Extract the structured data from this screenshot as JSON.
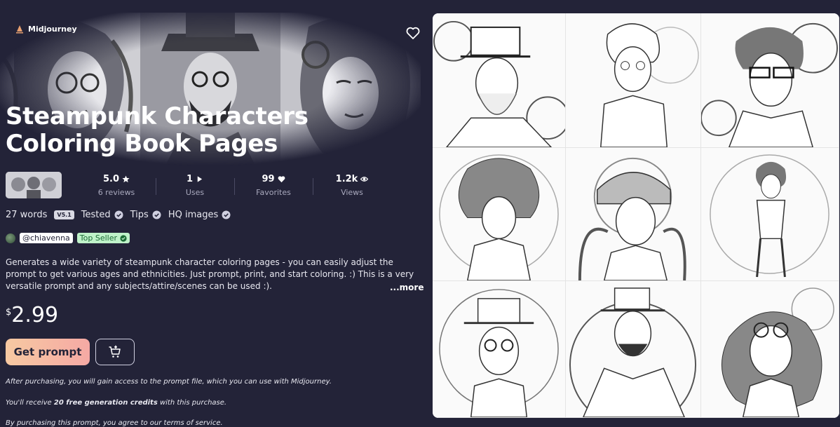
{
  "brand": {
    "name": "Midjourney",
    "icon": "sail-icon"
  },
  "favorite_icon": "heart-outline-icon",
  "title": "Steampunk Characters Coloring Book Pages",
  "stats": {
    "rating": {
      "value": "5.0",
      "label": "6 reviews",
      "icon": "star-icon"
    },
    "uses": {
      "value": "1",
      "label": "Uses",
      "icon": "play-icon"
    },
    "favorites": {
      "value": "99",
      "label": "Favorites",
      "icon": "heart-icon"
    },
    "views": {
      "value": "1.2k",
      "label": "Views",
      "icon": "eye-icon"
    }
  },
  "meta": {
    "words": "27 words",
    "version": "V5.1",
    "tested": "Tested",
    "tips": "Tips",
    "hq": "HQ images"
  },
  "seller": {
    "handle": "@chiavenna",
    "badge": "Top Seller"
  },
  "description": "Generates a wide variety of steampunk character coloring pages - you can easily adjust the prompt to get various ages and ethnicities. Just prompt, print, and  start coloring. :) This is a very versatile prompt and any subjects/attire/scenes can be used :).",
  "more_label": "...more",
  "price": {
    "currency": "$",
    "amount": "2.99"
  },
  "buttons": {
    "get_prompt": "Get prompt",
    "cart_icon": "add-to-cart-icon"
  },
  "fine_print": {
    "line1": "After purchasing, you will gain access to the prompt file, which you can use with Midjourney.",
    "line2_pre": "You'll receive ",
    "line2_bold": "20 free generation credits",
    "line2_post": " with this purchase.",
    "line3": "By purchasing this prompt, you agree to our terms of service."
  },
  "colors": {
    "background": "#232338",
    "get_prompt_gradient_start": "#f7c9a2",
    "get_prompt_gradient_end": "#f5a9a4",
    "top_seller_bg": "#bff2c9"
  }
}
